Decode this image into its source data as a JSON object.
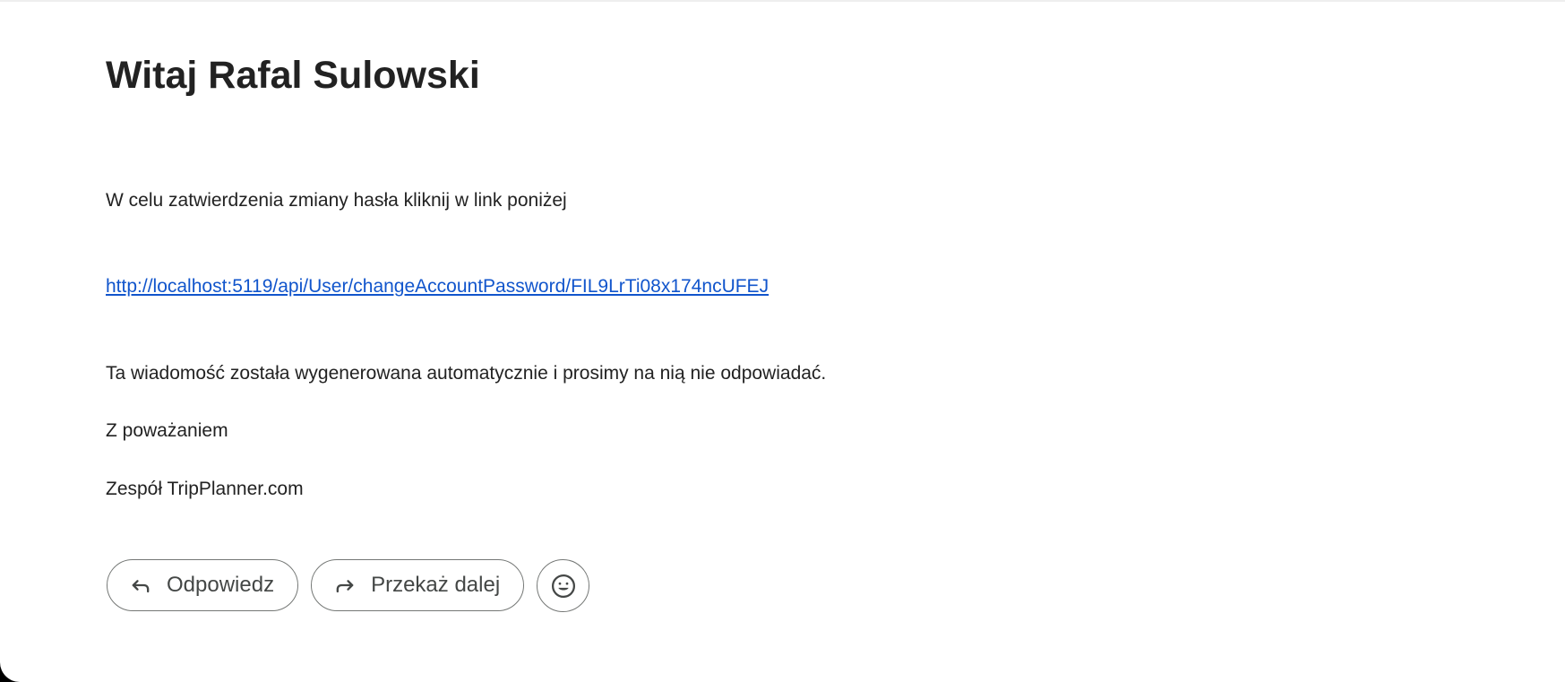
{
  "email": {
    "greeting": "Witaj Rafal Sulowski",
    "instruction": "W celu zatwierdzenia zmiany hasła kliknij w link poniżej",
    "link_text": "http://localhost:5119/api/User/changeAccountPassword/FIL9LrTi08x174ncUFEJ",
    "link_href": "http://localhost:5119/api/User/changeAccountPassword/FIL9LrTi08x174ncUFEJ",
    "auto_notice": "Ta wiadomość została wygenerowana automatycznie i prosimy na nią nie odpowiadać.",
    "regards": "Z poważaniem",
    "signature": "Zespół TripPlanner.com"
  },
  "actions": {
    "reply_label": "Odpowiedz",
    "reply_icon": "reply-icon",
    "forward_label": "Przekaż dalej",
    "forward_icon": "forward-icon",
    "emoji_icon": "emoji-icon"
  },
  "colors": {
    "link": "#1155cc",
    "text": "#222222",
    "button_border": "#747775",
    "button_text": "#444746"
  }
}
